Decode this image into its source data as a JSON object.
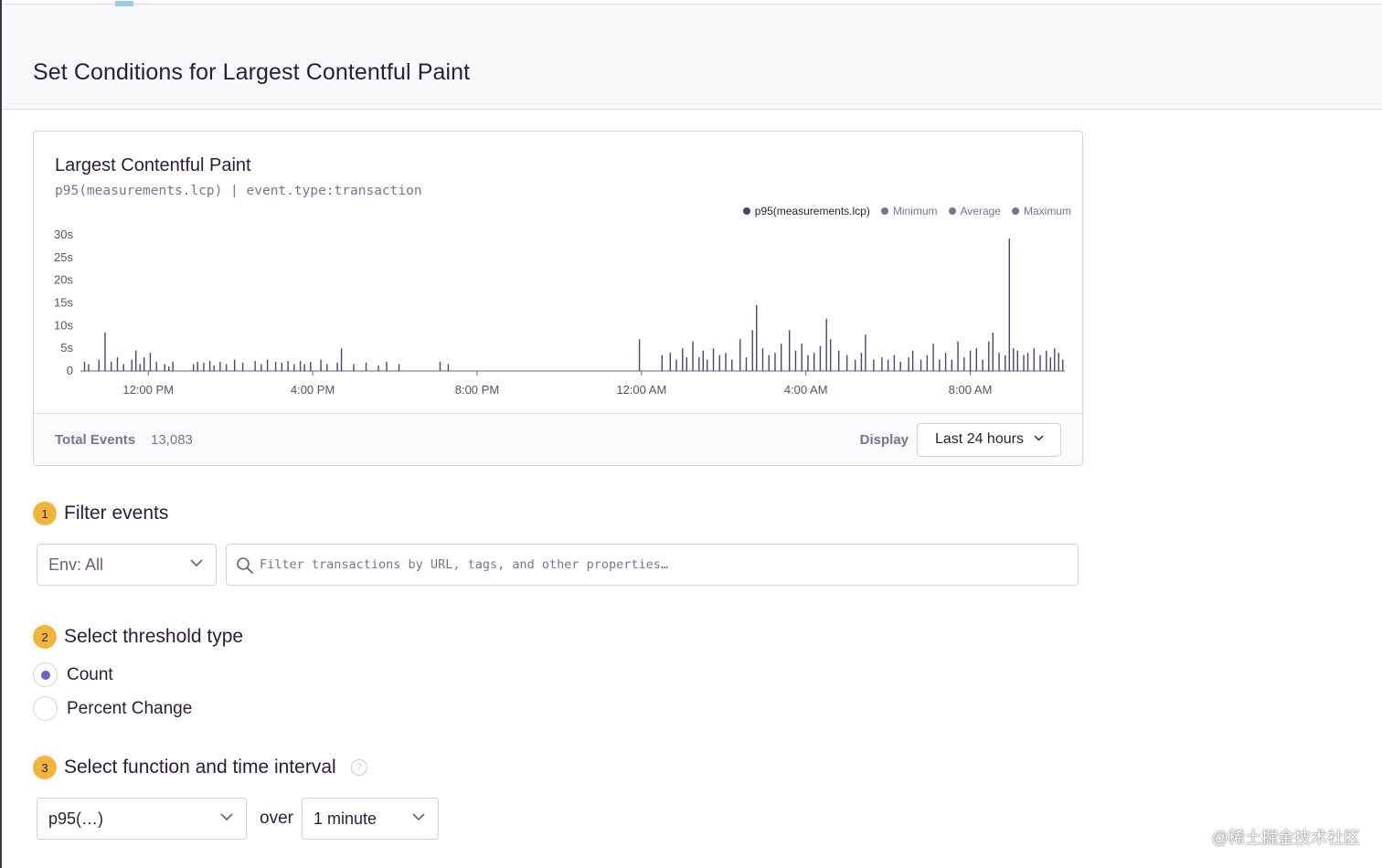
{
  "header": {
    "title": "Set Conditions for Largest Contentful Paint"
  },
  "chart_panel": {
    "title": "Largest Contentful Paint",
    "subtitle": "p95(measurements.lcp) | event.type:transaction",
    "legend": [
      {
        "label": "p95(measurements.lcp)",
        "color": "#444674",
        "primary": true
      },
      {
        "label": "Minimum",
        "color": "#80708f",
        "primary": false
      },
      {
        "label": "Average",
        "color": "#80708f",
        "primary": false
      },
      {
        "label": "Maximum",
        "color": "#80708f",
        "primary": false
      }
    ],
    "footer": {
      "total_label": "Total Events",
      "total_value": "13,083",
      "display_label": "Display",
      "display_value": "Last 24 hours"
    }
  },
  "chart_data": {
    "type": "bar",
    "ylim": [
      0,
      30
    ],
    "y_ticks": [
      "30s",
      "25s",
      "20s",
      "15s",
      "10s",
      "5s",
      "0"
    ],
    "x_ticks": [
      "12:00 PM",
      "4:00 PM",
      "8:00 PM",
      "12:00 AM",
      "4:00 AM",
      "8:00 AM"
    ],
    "x_tick_hours": [
      0,
      4,
      8,
      12,
      16,
      20
    ],
    "x_range_hours": [
      -1.65,
      22.3
    ],
    "series": [
      {
        "name": "p95(measurements.lcp)",
        "color": "#444674",
        "points": [
          [
            -1.55,
            2
          ],
          [
            -1.45,
            1.5
          ],
          [
            -1.2,
            2.5
          ],
          [
            -1.05,
            8.5
          ],
          [
            -0.9,
            2
          ],
          [
            -0.75,
            3
          ],
          [
            -0.6,
            1.5
          ],
          [
            -0.4,
            2.5
          ],
          [
            -0.3,
            4.5
          ],
          [
            -0.2,
            1.5
          ],
          [
            -0.1,
            3
          ],
          [
            0.05,
            4
          ],
          [
            0.2,
            2
          ],
          [
            0.4,
            1.5
          ],
          [
            0.5,
            1
          ],
          [
            0.6,
            2
          ],
          [
            1.1,
            1.5
          ],
          [
            1.2,
            2
          ],
          [
            1.35,
            1.8
          ],
          [
            1.5,
            2.2
          ],
          [
            1.6,
            1.2
          ],
          [
            1.75,
            2
          ],
          [
            1.9,
            1.5
          ],
          [
            2.1,
            2.5
          ],
          [
            2.3,
            1.8
          ],
          [
            2.6,
            2.2
          ],
          [
            2.75,
            1.5
          ],
          [
            2.9,
            2.5
          ],
          [
            3.1,
            2
          ],
          [
            3.25,
            1.8
          ],
          [
            3.4,
            2.2
          ],
          [
            3.55,
            1.5
          ],
          [
            3.7,
            2.2
          ],
          [
            3.8,
            1.5
          ],
          [
            3.95,
            2
          ],
          [
            4.2,
            2.5
          ],
          [
            4.35,
            1.5
          ],
          [
            4.6,
            1.8
          ],
          [
            4.7,
            5
          ],
          [
            5.0,
            1.5
          ],
          [
            5.3,
            1.8
          ],
          [
            5.6,
            1.2
          ],
          [
            5.8,
            2
          ],
          [
            6.1,
            1.5
          ],
          [
            7.1,
            2
          ],
          [
            7.3,
            1.5
          ],
          [
            11.95,
            7
          ],
          [
            12.5,
            3.5
          ],
          [
            12.7,
            4
          ],
          [
            12.85,
            2.5
          ],
          [
            13.0,
            5
          ],
          [
            13.1,
            3
          ],
          [
            13.25,
            6.5
          ],
          [
            13.4,
            3
          ],
          [
            13.5,
            4.5
          ],
          [
            13.6,
            2.5
          ],
          [
            13.75,
            5
          ],
          [
            13.9,
            3.5
          ],
          [
            14.05,
            4
          ],
          [
            14.2,
            2.5
          ],
          [
            14.4,
            7
          ],
          [
            14.55,
            3
          ],
          [
            14.7,
            9
          ],
          [
            14.8,
            14.5
          ],
          [
            14.95,
            5
          ],
          [
            15.1,
            3.5
          ],
          [
            15.25,
            4
          ],
          [
            15.4,
            6
          ],
          [
            15.6,
            9
          ],
          [
            15.75,
            4.5
          ],
          [
            15.9,
            6
          ],
          [
            16.05,
            3.5
          ],
          [
            16.2,
            4
          ],
          [
            16.35,
            5.5
          ],
          [
            16.5,
            11.5
          ],
          [
            16.6,
            7
          ],
          [
            16.8,
            4.5
          ],
          [
            17.0,
            3.5
          ],
          [
            17.2,
            2.5
          ],
          [
            17.35,
            4
          ],
          [
            17.45,
            8
          ],
          [
            17.65,
            2.5
          ],
          [
            17.85,
            3
          ],
          [
            18.0,
            2.5
          ],
          [
            18.15,
            3.5
          ],
          [
            18.3,
            2
          ],
          [
            18.5,
            3
          ],
          [
            18.6,
            4.5
          ],
          [
            18.8,
            2.5
          ],
          [
            18.95,
            3.5
          ],
          [
            19.1,
            6
          ],
          [
            19.25,
            2.5
          ],
          [
            19.4,
            4
          ],
          [
            19.55,
            2.5
          ],
          [
            19.7,
            6.5
          ],
          [
            19.85,
            3
          ],
          [
            20.0,
            4.5
          ],
          [
            20.15,
            5
          ],
          [
            20.3,
            2.5
          ],
          [
            20.45,
            6.5
          ],
          [
            20.55,
            8.5
          ],
          [
            20.7,
            4
          ],
          [
            20.85,
            3.5
          ],
          [
            20.95,
            29.2
          ],
          [
            21.05,
            5
          ],
          [
            21.15,
            4.5
          ],
          [
            21.3,
            3.5
          ],
          [
            21.4,
            4
          ],
          [
            21.55,
            5
          ],
          [
            21.7,
            3.5
          ],
          [
            21.85,
            4.5
          ],
          [
            21.95,
            3
          ],
          [
            22.05,
            5
          ],
          [
            22.15,
            4
          ],
          [
            22.25,
            2.5
          ]
        ]
      }
    ]
  },
  "steps": [
    {
      "number": "1",
      "title": "Filter events"
    },
    {
      "number": "2",
      "title": "Select threshold type"
    },
    {
      "number": "3",
      "title": "Select function and time interval"
    }
  ],
  "filter": {
    "env_value": "Env: All",
    "search_placeholder": "Filter transactions by URL, tags, and other properties…"
  },
  "threshold": {
    "options": [
      "Count",
      "Percent Change"
    ],
    "selected": "Count"
  },
  "function": {
    "value": "p95(…)",
    "over_label": "over",
    "interval_value": "1 minute"
  },
  "watermark": "@稀土掘金技术社区"
}
